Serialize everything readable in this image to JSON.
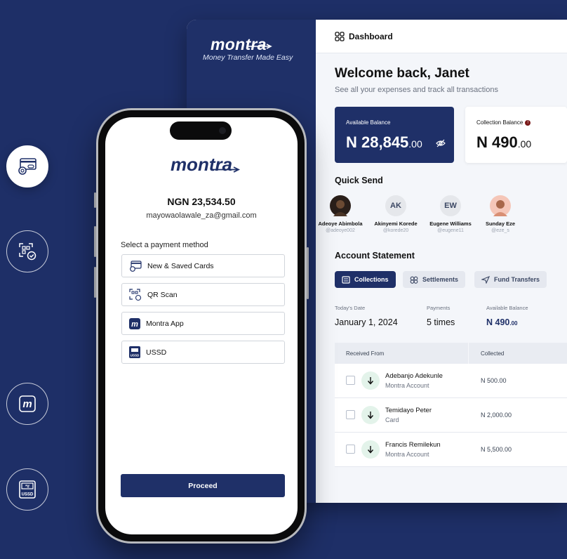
{
  "colors": {
    "brand_navy": "#1f3068",
    "background": "#1e2f67",
    "accent_green": "#e3f3ea"
  },
  "side_icons": [
    {
      "name": "card-payment-icon",
      "active": true
    },
    {
      "name": "qr-scan-icon",
      "active": false
    },
    {
      "name": "montra-app-icon",
      "active": false
    },
    {
      "name": "ussd-icon",
      "active": false
    }
  ],
  "dashboard": {
    "brand": {
      "logo": "montra",
      "tagline": "Money Transfer Made Easy"
    },
    "nav": {
      "title": "Dashboard",
      "icon": "grid-icon"
    },
    "welcome": "Welcome back, Janet",
    "welcome_sub": "See all your expenses and track all transactions",
    "available_balance": {
      "label": "Available Balance",
      "main": "N 28,845",
      "decimal": ".00"
    },
    "collection_balance": {
      "label": "Collection Balance",
      "main": "N 490",
      "decimal": ".00"
    },
    "quick_send": {
      "title": "Quick Send",
      "people": [
        {
          "name": "Adeoye Abimbola",
          "handle": "@adeoye002",
          "initials": ""
        },
        {
          "name": "Akinyemi Korede",
          "handle": "@korede20",
          "initials": "AK"
        },
        {
          "name": "Eugene Williams",
          "handle": "@eugene11",
          "initials": "EW"
        },
        {
          "name": "Sunday Eze",
          "handle": "@eze_s",
          "initials": ""
        }
      ]
    },
    "statement": {
      "title": "Account Statement",
      "tabs": [
        "Collections",
        "Settlements",
        "Fund Transfers"
      ],
      "stats": {
        "date_label": "Today's Date",
        "date_value": "January 1, 2024",
        "payments_label": "Payments",
        "payments_value": "5 times",
        "balance_label": "Available Balance",
        "balance_main": "N 490",
        "balance_decimal": ".00"
      },
      "table": {
        "headers": [
          "Received From",
          "Collected"
        ],
        "rows": [
          {
            "name": "Adebanjo Adekunle",
            "source": "Montra Account",
            "amount": "N 500.00"
          },
          {
            "name": "Temidayo Peter",
            "source": "Card",
            "amount": "N 2,000.00"
          },
          {
            "name": "Francis Remilekun",
            "source": "Montra Account",
            "amount": "N 5,500.00"
          }
        ]
      }
    }
  },
  "phone": {
    "logo": "montra",
    "amount": "NGN 23,534.50",
    "email": "mayowaolawale_za@gmail.com",
    "select_label": "Select a payment method",
    "options": [
      "New & Saved Cards",
      "QR Scan",
      "Montra App",
      "USSD"
    ],
    "proceed": "Proceed"
  }
}
